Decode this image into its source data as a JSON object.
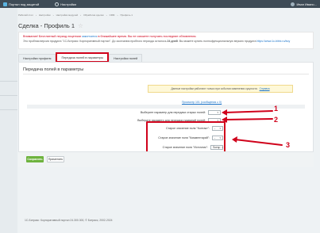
{
  "topbar": {
    "portal_label": "Портал под защитой",
    "settings_label": "Настройки",
    "user_name": "Иван Ивано..."
  },
  "breadcrumbs": [
    "Рабочий стол",
    "Настройки",
    "Настройки модулей",
    "Обработка сделки",
    "CRM",
    "Профиль 1"
  ],
  "page": {
    "title": "Сделка - Профиль 1",
    "star": "☆"
  },
  "notice": {
    "line1_text": "Внимание! Бесплатный период лицензии",
    "line1_link": "закончится",
    "line1_rest": "в ближайшее время. Вы не сможете получать последние обновления.",
    "line2_text": "Это пробная версия продукта \"1С-Битрикс: Корпоративный портал\". До окончания пробного периода осталось",
    "line2_days": "24 дней",
    "line2_rest": ". Вы можете купить полнофункциональную версию продукта",
    "line2_link": "https://www.1c-bitrix.ru/buy"
  },
  "tabs": [
    {
      "label": "Настройки профиля"
    },
    {
      "label": "Передача полей в параметры"
    },
    {
      "label": "Настройки полей"
    }
  ],
  "panel": {
    "title": "Передача полей в параметры",
    "warning_text": "Данные настройки работают только при событии изменения сущности.",
    "warning_link": "Справка",
    "prop_link": "Просмотр 101 (сообщения ≥ 0)"
  },
  "fields": {
    "row1_label": "Выберите параметр для передачи старых полей:",
    "row1_value": "",
    "row2_label": "Выберите параметр для передачи названий полей:",
    "row2_value": "",
    "row3_label": "Старое значение поля \"Контакт\":",
    "row3_value": "-",
    "row4_label": "Старое значение поля \"Комментарий\":",
    "row4_value": "-",
    "row5_label": "Старое значение поля \"Источник\":",
    "row5_value": "Sorsp"
  },
  "annotations": [
    "1",
    "2",
    "3"
  ],
  "buttons": {
    "save": "Сохранить",
    "apply": "Применить"
  },
  "footer": "1С-Битрикс: Корпоративный портал 24.300.300, © Битрикс, 2002-2024",
  "colors": {
    "accent_red": "#d0021b",
    "save_green": "#6eb33e",
    "topbar": "#3e4b56",
    "link": "#1a73c9"
  }
}
